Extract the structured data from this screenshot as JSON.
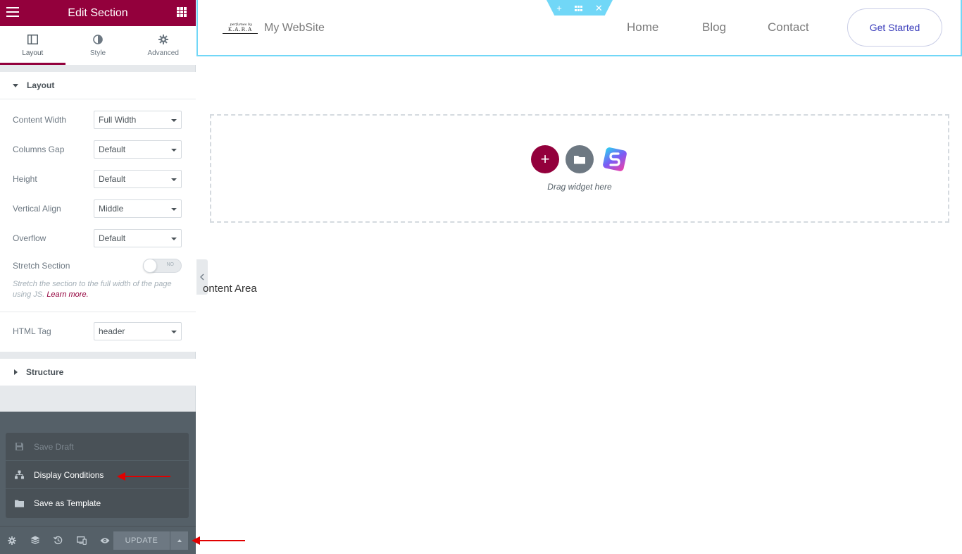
{
  "panel": {
    "title": "Edit Section",
    "tabs": [
      {
        "label": "Layout",
        "icon": "columns-icon"
      },
      {
        "label": "Style",
        "icon": "half-circle-icon"
      },
      {
        "label": "Advanced",
        "icon": "gear-icon"
      }
    ],
    "layout_section": {
      "title": "Layout",
      "controls": [
        {
          "label": "Content Width",
          "value": "Full Width"
        },
        {
          "label": "Columns Gap",
          "value": "Default"
        },
        {
          "label": "Height",
          "value": "Default"
        },
        {
          "label": "Vertical Align",
          "value": "Middle"
        },
        {
          "label": "Overflow",
          "value": "Default"
        }
      ],
      "stretch": {
        "label": "Stretch Section",
        "toggle_text": "NO",
        "help": "Stretch the section to the full width of the page using JS.",
        "learn_more": "Learn more."
      },
      "html_tag": {
        "label": "HTML Tag",
        "value": "header"
      }
    },
    "structure_section": {
      "title": "Structure"
    },
    "save_menu": {
      "save_draft": "Save Draft",
      "display_conditions": "Display Conditions",
      "save_as_template": "Save as Template"
    },
    "footer": {
      "update": "UPDATE"
    }
  },
  "site": {
    "logo_text": "K.A.R.A",
    "logo_small": "perfumes by",
    "title": "My WebSite",
    "nav": [
      "Home",
      "Blog",
      "Contact"
    ],
    "cta": "Get Started"
  },
  "canvas": {
    "drop_text": "Drag widget here",
    "content_area": "ontent Area"
  },
  "colors": {
    "brand": "#93003c",
    "section_outline": "#71d7f7",
    "panel_dark": "#556068",
    "annotation": "#e10000"
  }
}
